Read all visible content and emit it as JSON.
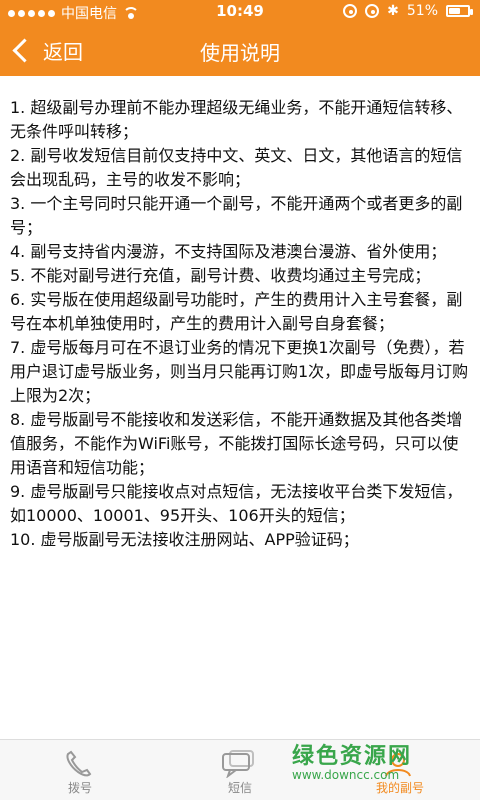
{
  "status": {
    "carrier": "中国电信",
    "time": "10:49",
    "battery": "51%"
  },
  "header": {
    "back_label": "返回",
    "title": "使用说明"
  },
  "rules": [
    "1. 超级副号办理前不能办理超级无绳业务，不能开通短信转移、无条件呼叫转移；",
    "2. 副号收发短信目前仅支持中文、英文、日文，其他语言的短信会出现乱码，主号的收发不影响；",
    "3. 一个主号同时只能开通一个副号，不能开通两个或者更多的副号；",
    "4. 副号支持省内漫游，不支持国际及港澳台漫游、省外使用；",
    "5. 不能对副号进行充值，副号计费、收费均通过主号完成；",
    "6. 实号版在使用超级副号功能时，产生的费用计入主号套餐，副号在本机单独使用时，产生的费用计入副号自身套餐；",
    "7. 虚号版每月可在不退订业务的情况下更换1次副号（免费），若用户退订虚号版业务，则当月只能再订购1次，即虚号版每月订购上限为2次；",
    "8. 虚号版副号不能接收和发送彩信，不能开通数据及其他各类增值服务，不能作为WiFi账号，不能拨打国际长途号码，只可以使用语音和短信功能；",
    "9. 虚号版副号只能接收点对点短信，无法接收平台类下发短信，如10000、10001、95开头、106开头的短信；",
    "10. 虚号版副号无法接收注册网站、APP验证码；"
  ],
  "tabs": [
    {
      "label": "拨号",
      "icon": "phone-icon"
    },
    {
      "label": "短信",
      "icon": "message-icon"
    },
    {
      "label": "我的副号",
      "icon": "profile-icon"
    }
  ],
  "watermark": {
    "title": "绿色资源网",
    "url": "www.downcc.com"
  },
  "colors": {
    "accent": "#f28a1f",
    "watermark": "#39a64b"
  }
}
